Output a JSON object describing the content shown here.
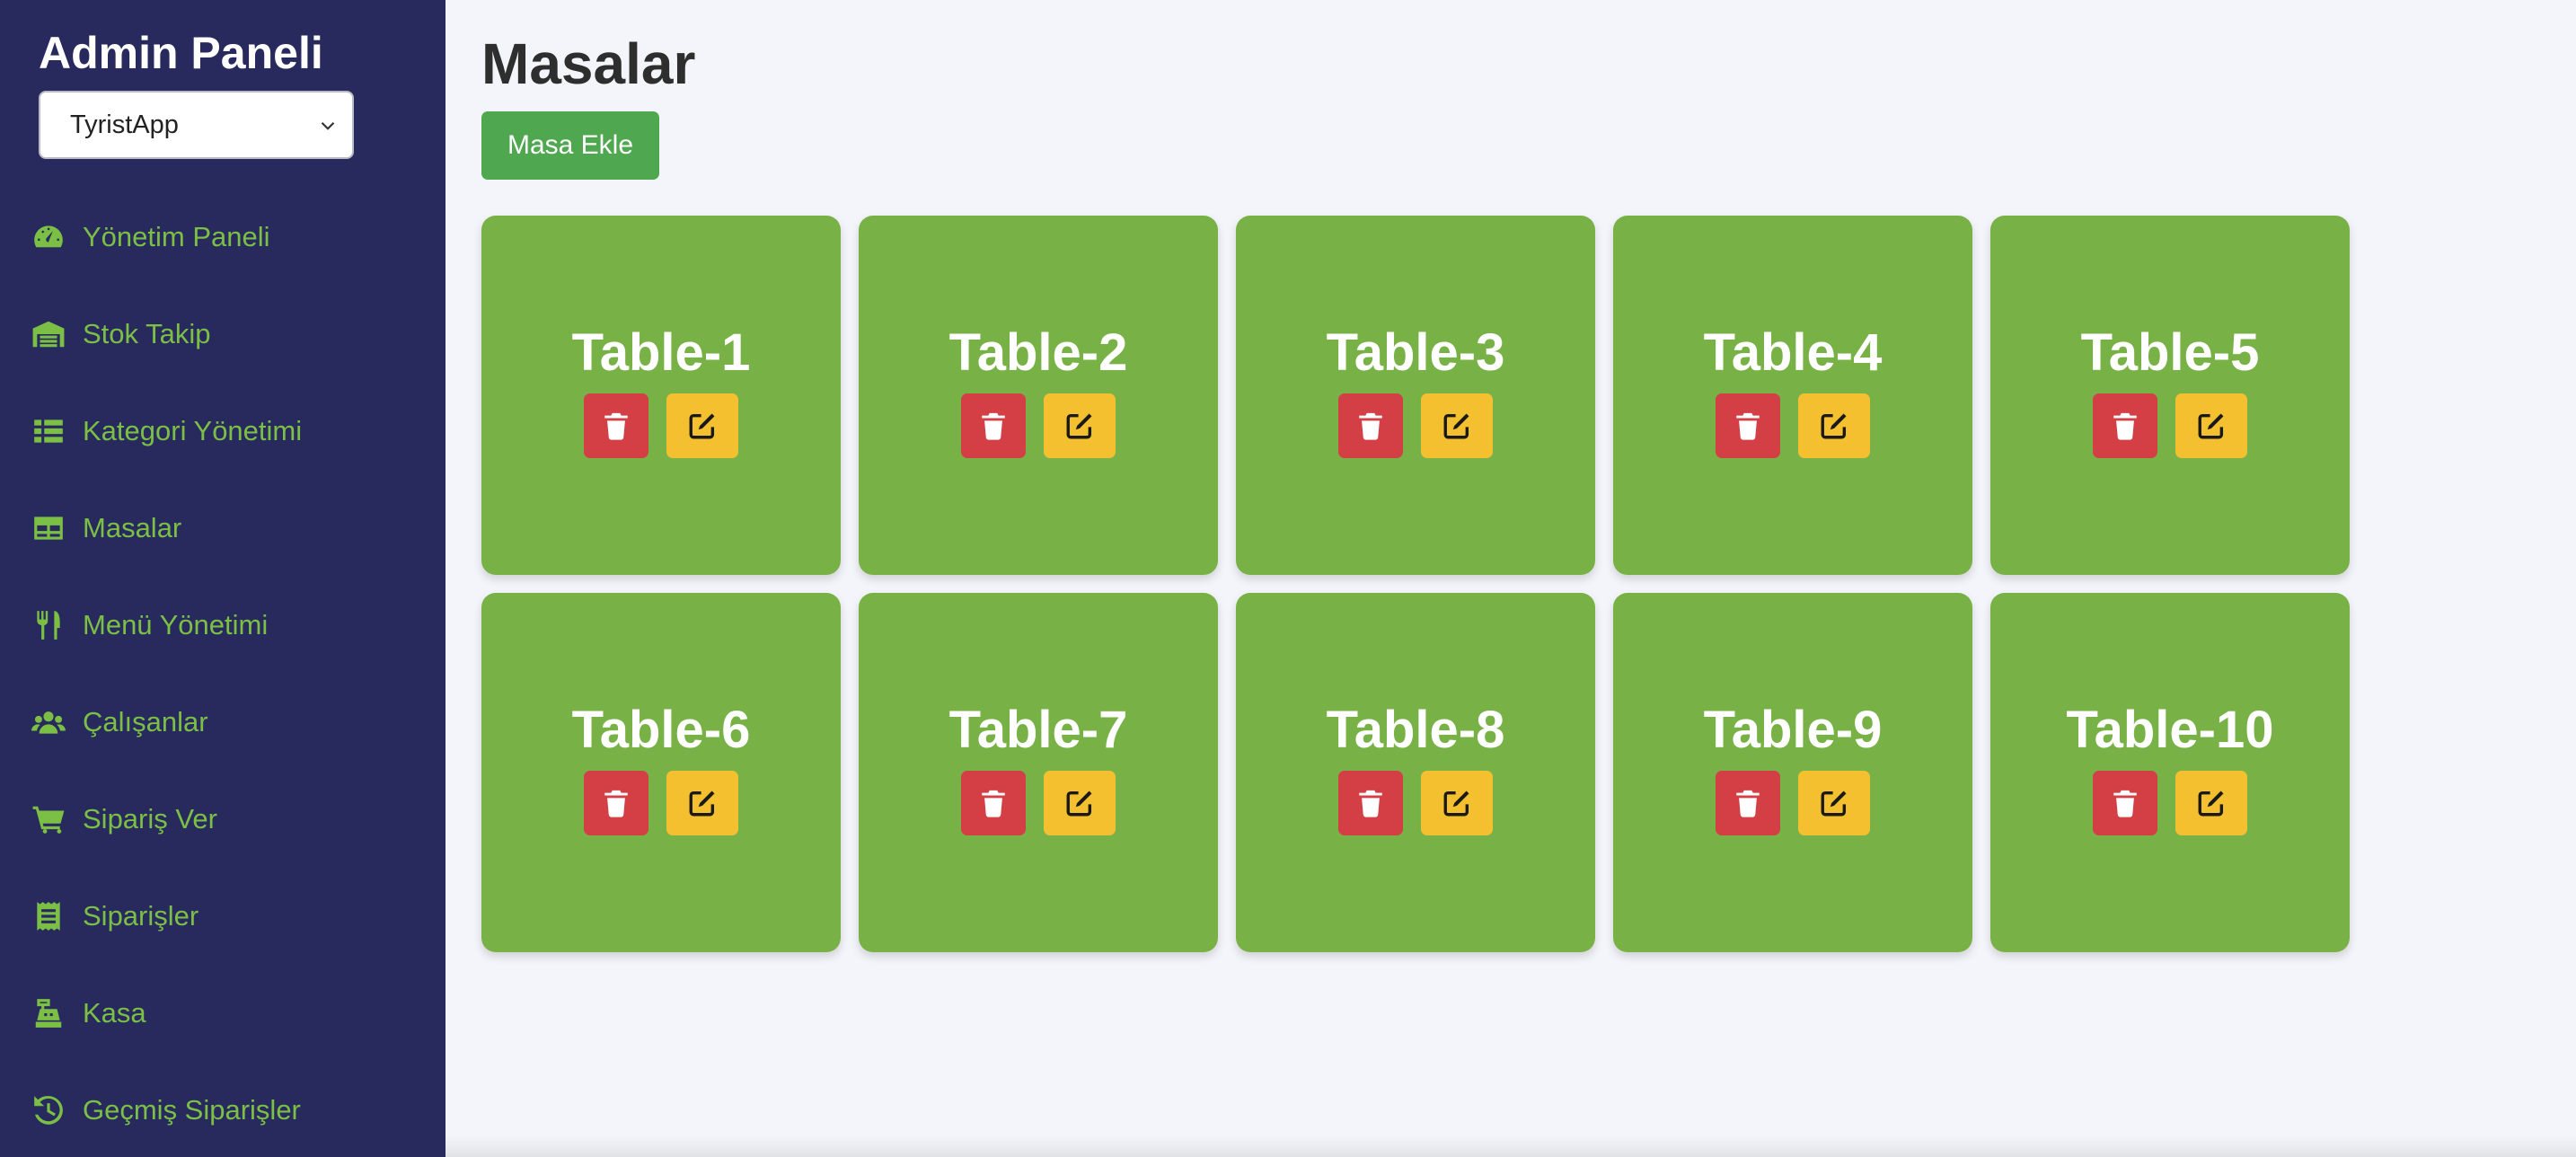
{
  "sidebar": {
    "brand": "Admin Paneli",
    "select": {
      "value": "TyristApp"
    },
    "items": [
      {
        "label": "Yönetim Paneli",
        "icon": "gauge-icon"
      },
      {
        "label": "Stok Takip",
        "icon": "warehouse-icon"
      },
      {
        "label": "Kategori Yönetimi",
        "icon": "list-icon"
      },
      {
        "label": "Masalar",
        "icon": "table-icon"
      },
      {
        "label": "Menü Yönetimi",
        "icon": "utensils-icon"
      },
      {
        "label": "Çalışanlar",
        "icon": "users-icon"
      },
      {
        "label": "Sipariş Ver",
        "icon": "cart-icon"
      },
      {
        "label": "Siparişler",
        "icon": "receipt-icon"
      },
      {
        "label": "Kasa",
        "icon": "cash-register-icon"
      },
      {
        "label": "Geçmiş Siparişler",
        "icon": "history-icon"
      }
    ],
    "accent_color": "#7bbf45",
    "background_color": "#282a5e"
  },
  "main": {
    "title": "Masalar",
    "add_button_label": "Masa Ekle",
    "tables": [
      {
        "name": "Table-1"
      },
      {
        "name": "Table-2"
      },
      {
        "name": "Table-3"
      },
      {
        "name": "Table-4"
      },
      {
        "name": "Table-5"
      },
      {
        "name": "Table-6"
      },
      {
        "name": "Table-7"
      },
      {
        "name": "Table-8"
      },
      {
        "name": "Table-9"
      },
      {
        "name": "Table-10"
      }
    ],
    "card_color": "#78b246",
    "delete_color": "#d33f45",
    "edit_color": "#f4c02f"
  }
}
